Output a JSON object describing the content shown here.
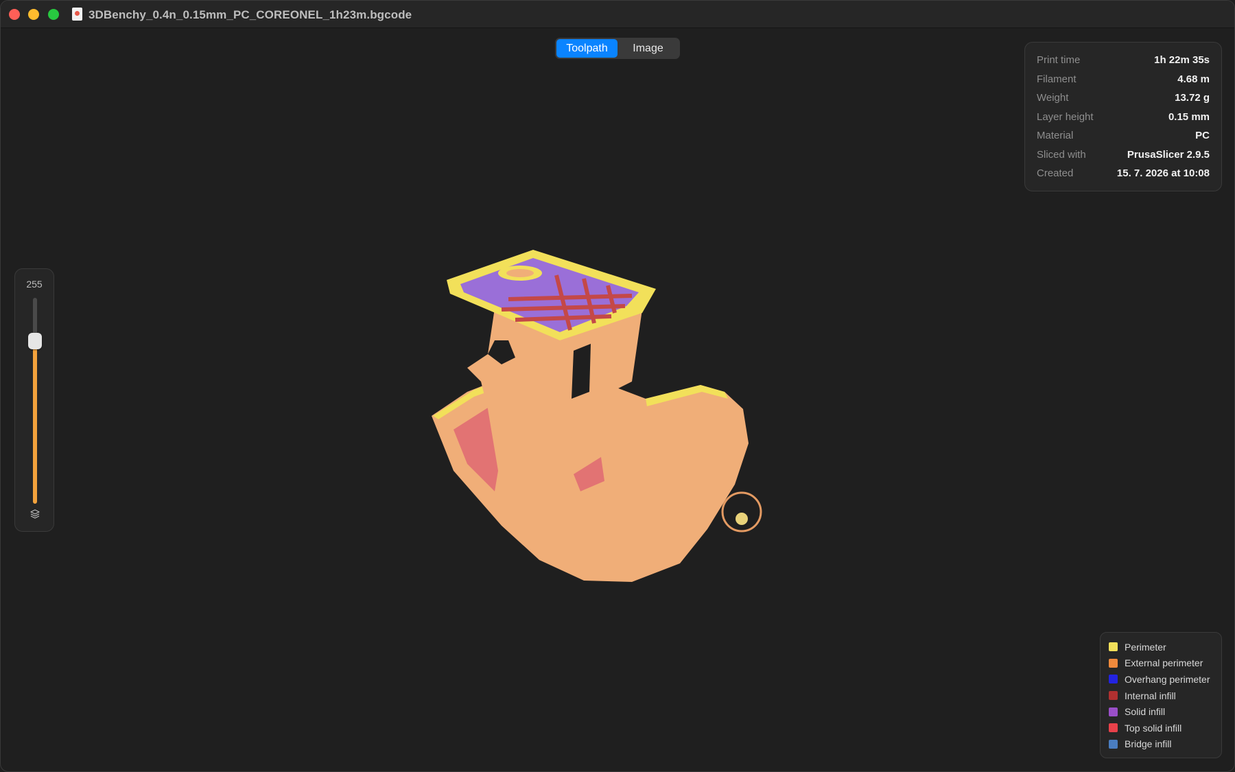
{
  "window": {
    "title": "3DBenchy_0.4n_0.15mm_PC_COREONEL_1h23m.bgcode"
  },
  "view_toggle": {
    "options": [
      "Toolpath",
      "Image"
    ],
    "selected": "Toolpath"
  },
  "print_info": {
    "rows": [
      {
        "label": "Print time",
        "value": "1h 22m 35s"
      },
      {
        "label": "Filament",
        "value": "4.68 m"
      },
      {
        "label": "Weight",
        "value": "13.72 g"
      },
      {
        "label": "Layer height",
        "value": "0.15 mm"
      },
      {
        "label": "Material",
        "value": "PC"
      },
      {
        "label": "Sliced with",
        "value": "PrusaSlicer 2.9.5"
      },
      {
        "label": "Created",
        "value": "15. 7. 2026 at 10:08"
      }
    ]
  },
  "layer_slider": {
    "value": "255",
    "fraction": 0.79,
    "icon": "layers-icon"
  },
  "legend": {
    "items": [
      {
        "label": "Perimeter",
        "color": "#f2e05a"
      },
      {
        "label": "External perimeter",
        "color": "#f08a3c"
      },
      {
        "label": "Overhang perimeter",
        "color": "#2323e0"
      },
      {
        "label": "Internal infill",
        "color": "#b03030"
      },
      {
        "label": "Solid infill",
        "color": "#9a4fc8"
      },
      {
        "label": "Top solid infill",
        "color": "#e8414a"
      },
      {
        "label": "Bridge infill",
        "color": "#4a7dc0"
      }
    ]
  },
  "colors": {
    "accent": "#0a84ff",
    "model_body": "#f0ae78",
    "slider_fill": "#f3a23c"
  }
}
